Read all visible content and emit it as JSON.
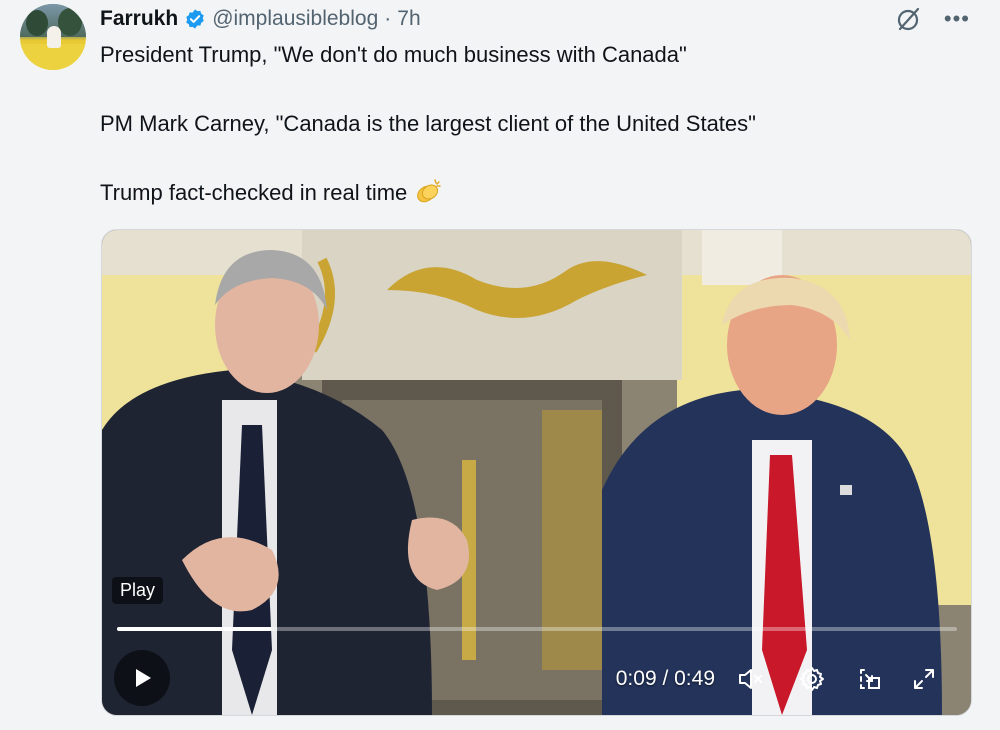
{
  "tweet": {
    "author_name": "Farrukh",
    "handle": "@implausibleblog",
    "separator": "·",
    "time": "7h",
    "lines": [
      "President Trump, \"We don't do much business with Canada\"",
      "PM Mark Carney, \"Canada is the largest client of the United States\"",
      "Trump fact-checked in real time"
    ],
    "emoji_icon": "clapping-hands-icon"
  },
  "video": {
    "play_label": "Play",
    "current_time": "0:09",
    "duration": "0:49",
    "time_display": "0:09 / 0:49",
    "progress_fraction": 0.184
  },
  "colors": {
    "accent_verified": "#1d9bf0",
    "text_primary": "#0f1419",
    "text_secondary": "#536471",
    "background": "#f3f4f6"
  }
}
